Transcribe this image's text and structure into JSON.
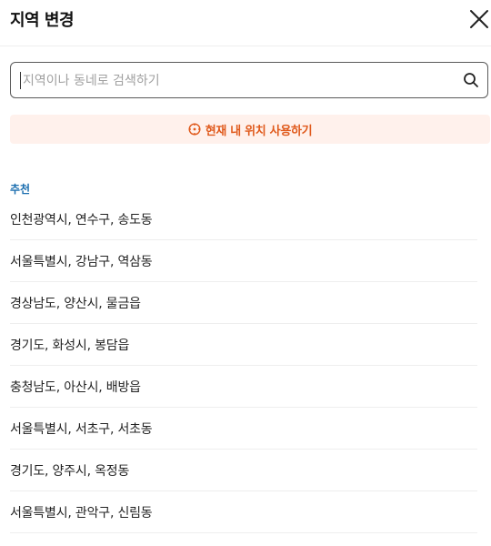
{
  "header": {
    "title": "지역 변경",
    "close_icon": "close-icon"
  },
  "search": {
    "placeholder": "지역이나 동네로 검색하기",
    "value": "",
    "icon": "search-icon"
  },
  "location_button": {
    "label": "현재 내 위치 사용하기",
    "icon": "crosshair-icon",
    "text_color": "#e05a1c",
    "background_color": "#fff1ec"
  },
  "recommend": {
    "label": "추천",
    "label_color": "#1d6fb0",
    "items": [
      "인천광역시, 연수구, 송도동",
      "서울특별시, 강남구, 역삼동",
      "경상남도, 양산시, 물금읍",
      "경기도, 화성시, 봉담읍",
      "충청남도, 아산시, 배방읍",
      "서울특별시, 서초구, 서초동",
      "경기도, 양주시, 옥정동",
      "서울특별시, 관악구, 신림동"
    ]
  }
}
